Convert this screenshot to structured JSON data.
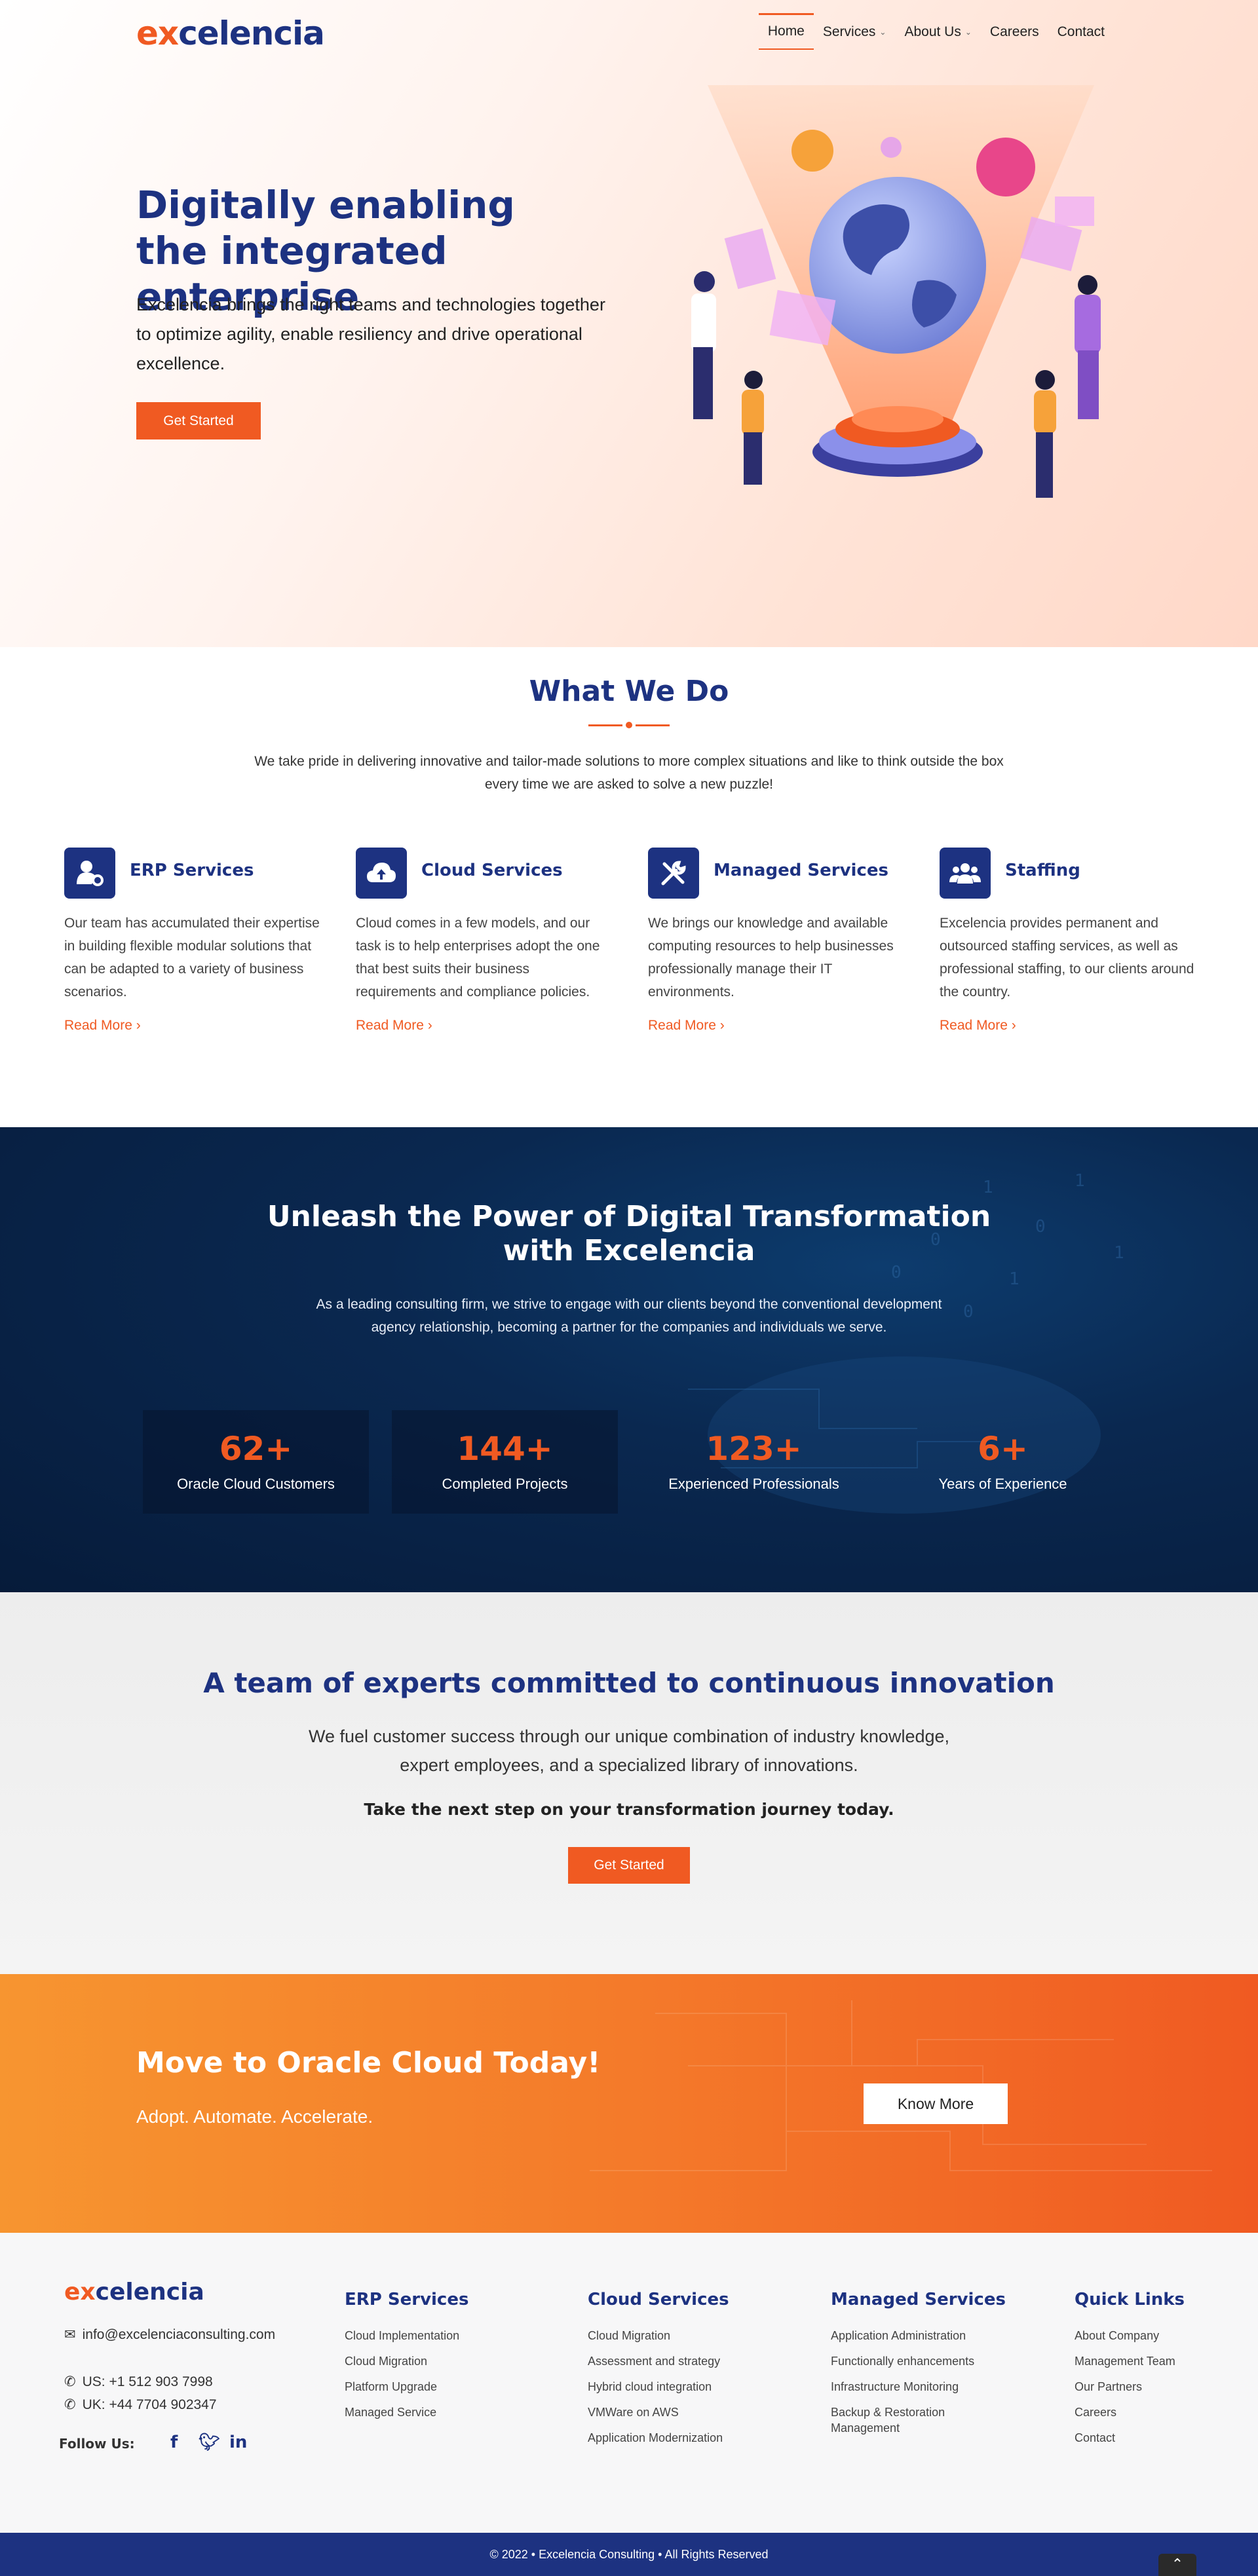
{
  "header": {
    "logo_ex": "ex",
    "logo_rest": "celencia",
    "nav": [
      {
        "label": "Home",
        "active": true,
        "dropdown": false
      },
      {
        "label": "Services",
        "active": false,
        "dropdown": true
      },
      {
        "label": "About Us",
        "active": false,
        "dropdown": true
      },
      {
        "label": "Careers",
        "active": false,
        "dropdown": false
      },
      {
        "label": "Contact",
        "active": false,
        "dropdown": false
      }
    ]
  },
  "hero": {
    "title_line1": "Digitally enabling",
    "title_line2": "the integrated enterprise",
    "text": "Excelencia brings the right teams and technologies together to optimize agility, enable resiliency and drive operational excellence.",
    "button": "Get Started"
  },
  "what_we_do": {
    "title": "What We Do",
    "text": "We take pride in delivering innovative and tailor-made solutions to more complex situations and like to think outside the box every time we are asked to solve a new puzzle!",
    "services": [
      {
        "title": "ERP Services",
        "icon": "user-gear-icon",
        "text": "Our team has accumulated their expertise in building flexible modular solutions that can be adapted to a variety of business scenarios.",
        "link": "Read More ›"
      },
      {
        "title": "Cloud Services",
        "icon": "cloud-upload-icon",
        "text": "Cloud comes in a few models, and our task is to help enterprises adopt the one that best suits their business requirements and compliance policies.",
        "link": "Read More ›"
      },
      {
        "title": "Managed Services",
        "icon": "tools-icon",
        "text": "We brings our knowledge and available computing resources to help businesses professionally manage their IT environments.",
        "link": "Read More ›"
      },
      {
        "title": "Staffing",
        "icon": "users-icon",
        "text": "Excelencia provides permanent and outsourced staffing services, as well as professional staffing, to our clients around the country.",
        "link": "Read More ›"
      }
    ]
  },
  "transformation": {
    "title_line1": "Unleash the Power of Digital Transformation",
    "title_line2": "with Excelencia",
    "text": "As a leading consulting firm, we strive to engage with our clients beyond the conventional development agency relationship, becoming a partner for the companies and individuals we serve.",
    "stats": [
      {
        "value": "62+",
        "label": "Oracle Cloud Customers"
      },
      {
        "value": "144+",
        "label": "Completed Projects"
      },
      {
        "value": "123+",
        "label": "Experienced Professionals"
      },
      {
        "value": "6+",
        "label": "Years of Experience"
      }
    ]
  },
  "team": {
    "title": "A team of experts committed to continuous innovation",
    "text": "We fuel customer success through our unique combination of industry knowledge, expert employees, and a specialized library of innovations.",
    "cta": "Take the next step on your transformation journey today.",
    "button": "Get Started"
  },
  "oracle": {
    "title": "Move to Oracle Cloud Today!",
    "subtitle": "Adopt. Automate. Accelerate.",
    "button": "Know More"
  },
  "footer": {
    "logo_ex": "ex",
    "logo_rest": "celencia",
    "email": "info@excelenciaconsulting.com",
    "phone_us": "US: +1 512 903 7998",
    "phone_uk": "UK: +44 7704 902347",
    "follow": "Follow Us:",
    "columns": [
      {
        "title": "ERP Services",
        "links": [
          "Cloud Implementation",
          "Cloud Migration",
          "Platform Upgrade",
          "Managed Service"
        ]
      },
      {
        "title": "Cloud Services",
        "links": [
          "Cloud Migration",
          "Assessment and strategy",
          "Hybrid cloud integration",
          "VMWare on AWS",
          "Application Modernization"
        ]
      },
      {
        "title": "Managed Services",
        "links": [
          "Application Administration",
          "Functionally enhancements",
          "Infrastructure Monitoring",
          "Backup & Restoration Management"
        ]
      },
      {
        "title": "Quick Links",
        "links": [
          "About Company",
          "Management Team",
          "Our Partners",
          "Careers",
          "Contact"
        ]
      }
    ],
    "copyright": "© 2022 • Excelencia Consulting • All Rights Reserved"
  }
}
